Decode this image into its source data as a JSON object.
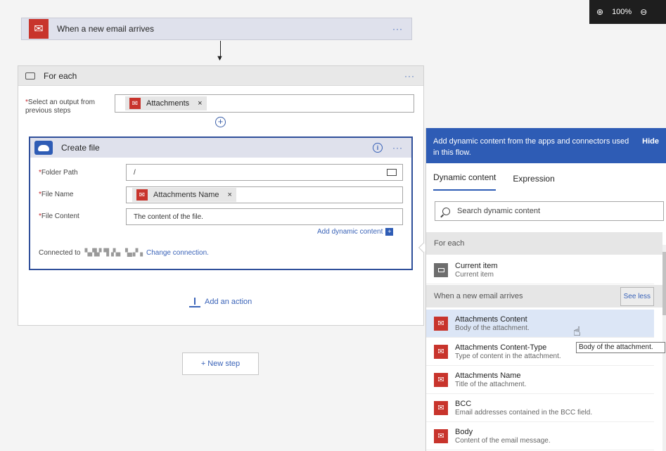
{
  "zoom": {
    "level": "100%"
  },
  "trigger": {
    "title": "When a new email arrives",
    "menu": "···"
  },
  "foreach": {
    "title": "For each",
    "menu": "···",
    "select_label": "Select an output from previous steps",
    "token": "Attachments",
    "token_remove": "×"
  },
  "create_file": {
    "title": "Create file",
    "menu": "···",
    "info": "i",
    "folder_label": "Folder Path",
    "folder_value": "/",
    "filename_label": "File Name",
    "filename_token": "Attachments Name",
    "filename_remove": "×",
    "content_label": "File Content",
    "content_placeholder": "The content of the file.",
    "add_dynamic": "Add dynamic content",
    "connected_prefix": "Connected to",
    "connected_account": "▚▞▙▘▜▗▚▖▝▄ ▞▗",
    "change_connection": "Change connection."
  },
  "add_action": "Add an action",
  "new_step": "+ New step",
  "panel": {
    "header": "Add dynamic content from the apps and connectors used in this flow.",
    "hide": "Hide",
    "tab_dynamic": "Dynamic content",
    "tab_expression": "Expression",
    "search_placeholder": "Search dynamic content",
    "group_foreach": "For each",
    "group_email": "When a new email arrives",
    "see_less": "See less",
    "items": [
      {
        "title": "Current item",
        "desc": "Current item"
      },
      {
        "title": "Attachments Content",
        "desc": "Body of the attachment."
      },
      {
        "title": "Attachments Content-Type",
        "desc": "Type of content in the attachment."
      },
      {
        "title": "Attachments Name",
        "desc": "Title of the attachment."
      },
      {
        "title": "BCC",
        "desc": "Email addresses contained in the BCC field."
      },
      {
        "title": "Body",
        "desc": "Content of the email message."
      }
    ]
  },
  "tooltip": "Body of the attachment.",
  "colors": {
    "accent": "#2e5cb5",
    "outlook": "#c8342c",
    "highlight": "#dce6f6"
  }
}
